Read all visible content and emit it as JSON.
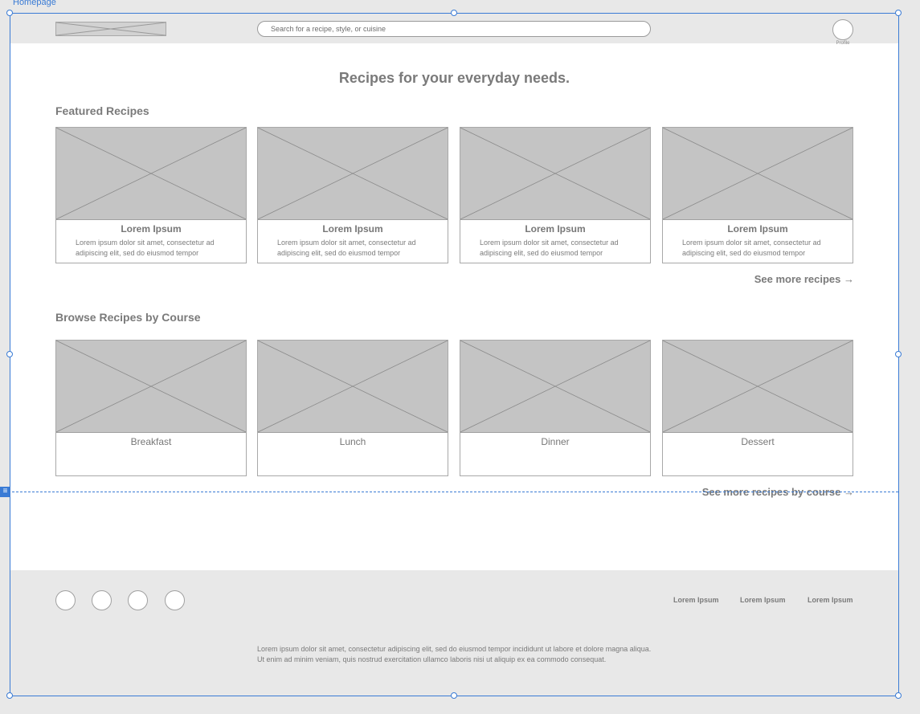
{
  "artboard": {
    "label": "Homepage"
  },
  "header": {
    "search_placeholder": "Search for a recipe, style, or cuisine",
    "profile_label": "Profile"
  },
  "hero": {
    "title": "Recipes for your everyday needs."
  },
  "featured": {
    "title": "Featured Recipes",
    "cards": [
      {
        "title": "Lorem Ipsum",
        "desc": "Lorem ipsum dolor sit amet, consectetur ad adipiscing elit, sed do eiusmod tempor"
      },
      {
        "title": "Lorem Ipsum",
        "desc": "Lorem ipsum dolor sit amet, consectetur ad adipiscing elit, sed do eiusmod tempor"
      },
      {
        "title": "Lorem Ipsum",
        "desc": "Lorem ipsum dolor sit amet, consectetur ad adipiscing elit, sed do eiusmod tempor"
      },
      {
        "title": "Lorem Ipsum",
        "desc": "Lorem ipsum dolor sit amet, consectetur ad adipiscing elit, sed do eiusmod tempor"
      }
    ],
    "see_more": "See more recipes →"
  },
  "courses": {
    "title": "Browse Recipes by Course",
    "cards": [
      {
        "title": "Breakfast"
      },
      {
        "title": "Lunch"
      },
      {
        "title": "Dinner"
      },
      {
        "title": "Dessert"
      }
    ],
    "see_more": "See more recipes by course →"
  },
  "footer": {
    "links": [
      "Lorem Ipsum",
      "Lorem Ipsum",
      "Lorem Ipsum"
    ],
    "text": "Lorem ipsum dolor sit amet, consectetur adipiscing elit, sed do eiusmod tempor incididunt ut labore et dolore magna aliqua. Ut enim ad minim veniam, quis nostrud exercitation ullamco laboris nisi ut aliquip ex ea commodo consequat."
  },
  "colors": {
    "selection": "#3a7bd5",
    "placeholder": "#c4c4c4",
    "chrome": "#e8e8e8"
  }
}
